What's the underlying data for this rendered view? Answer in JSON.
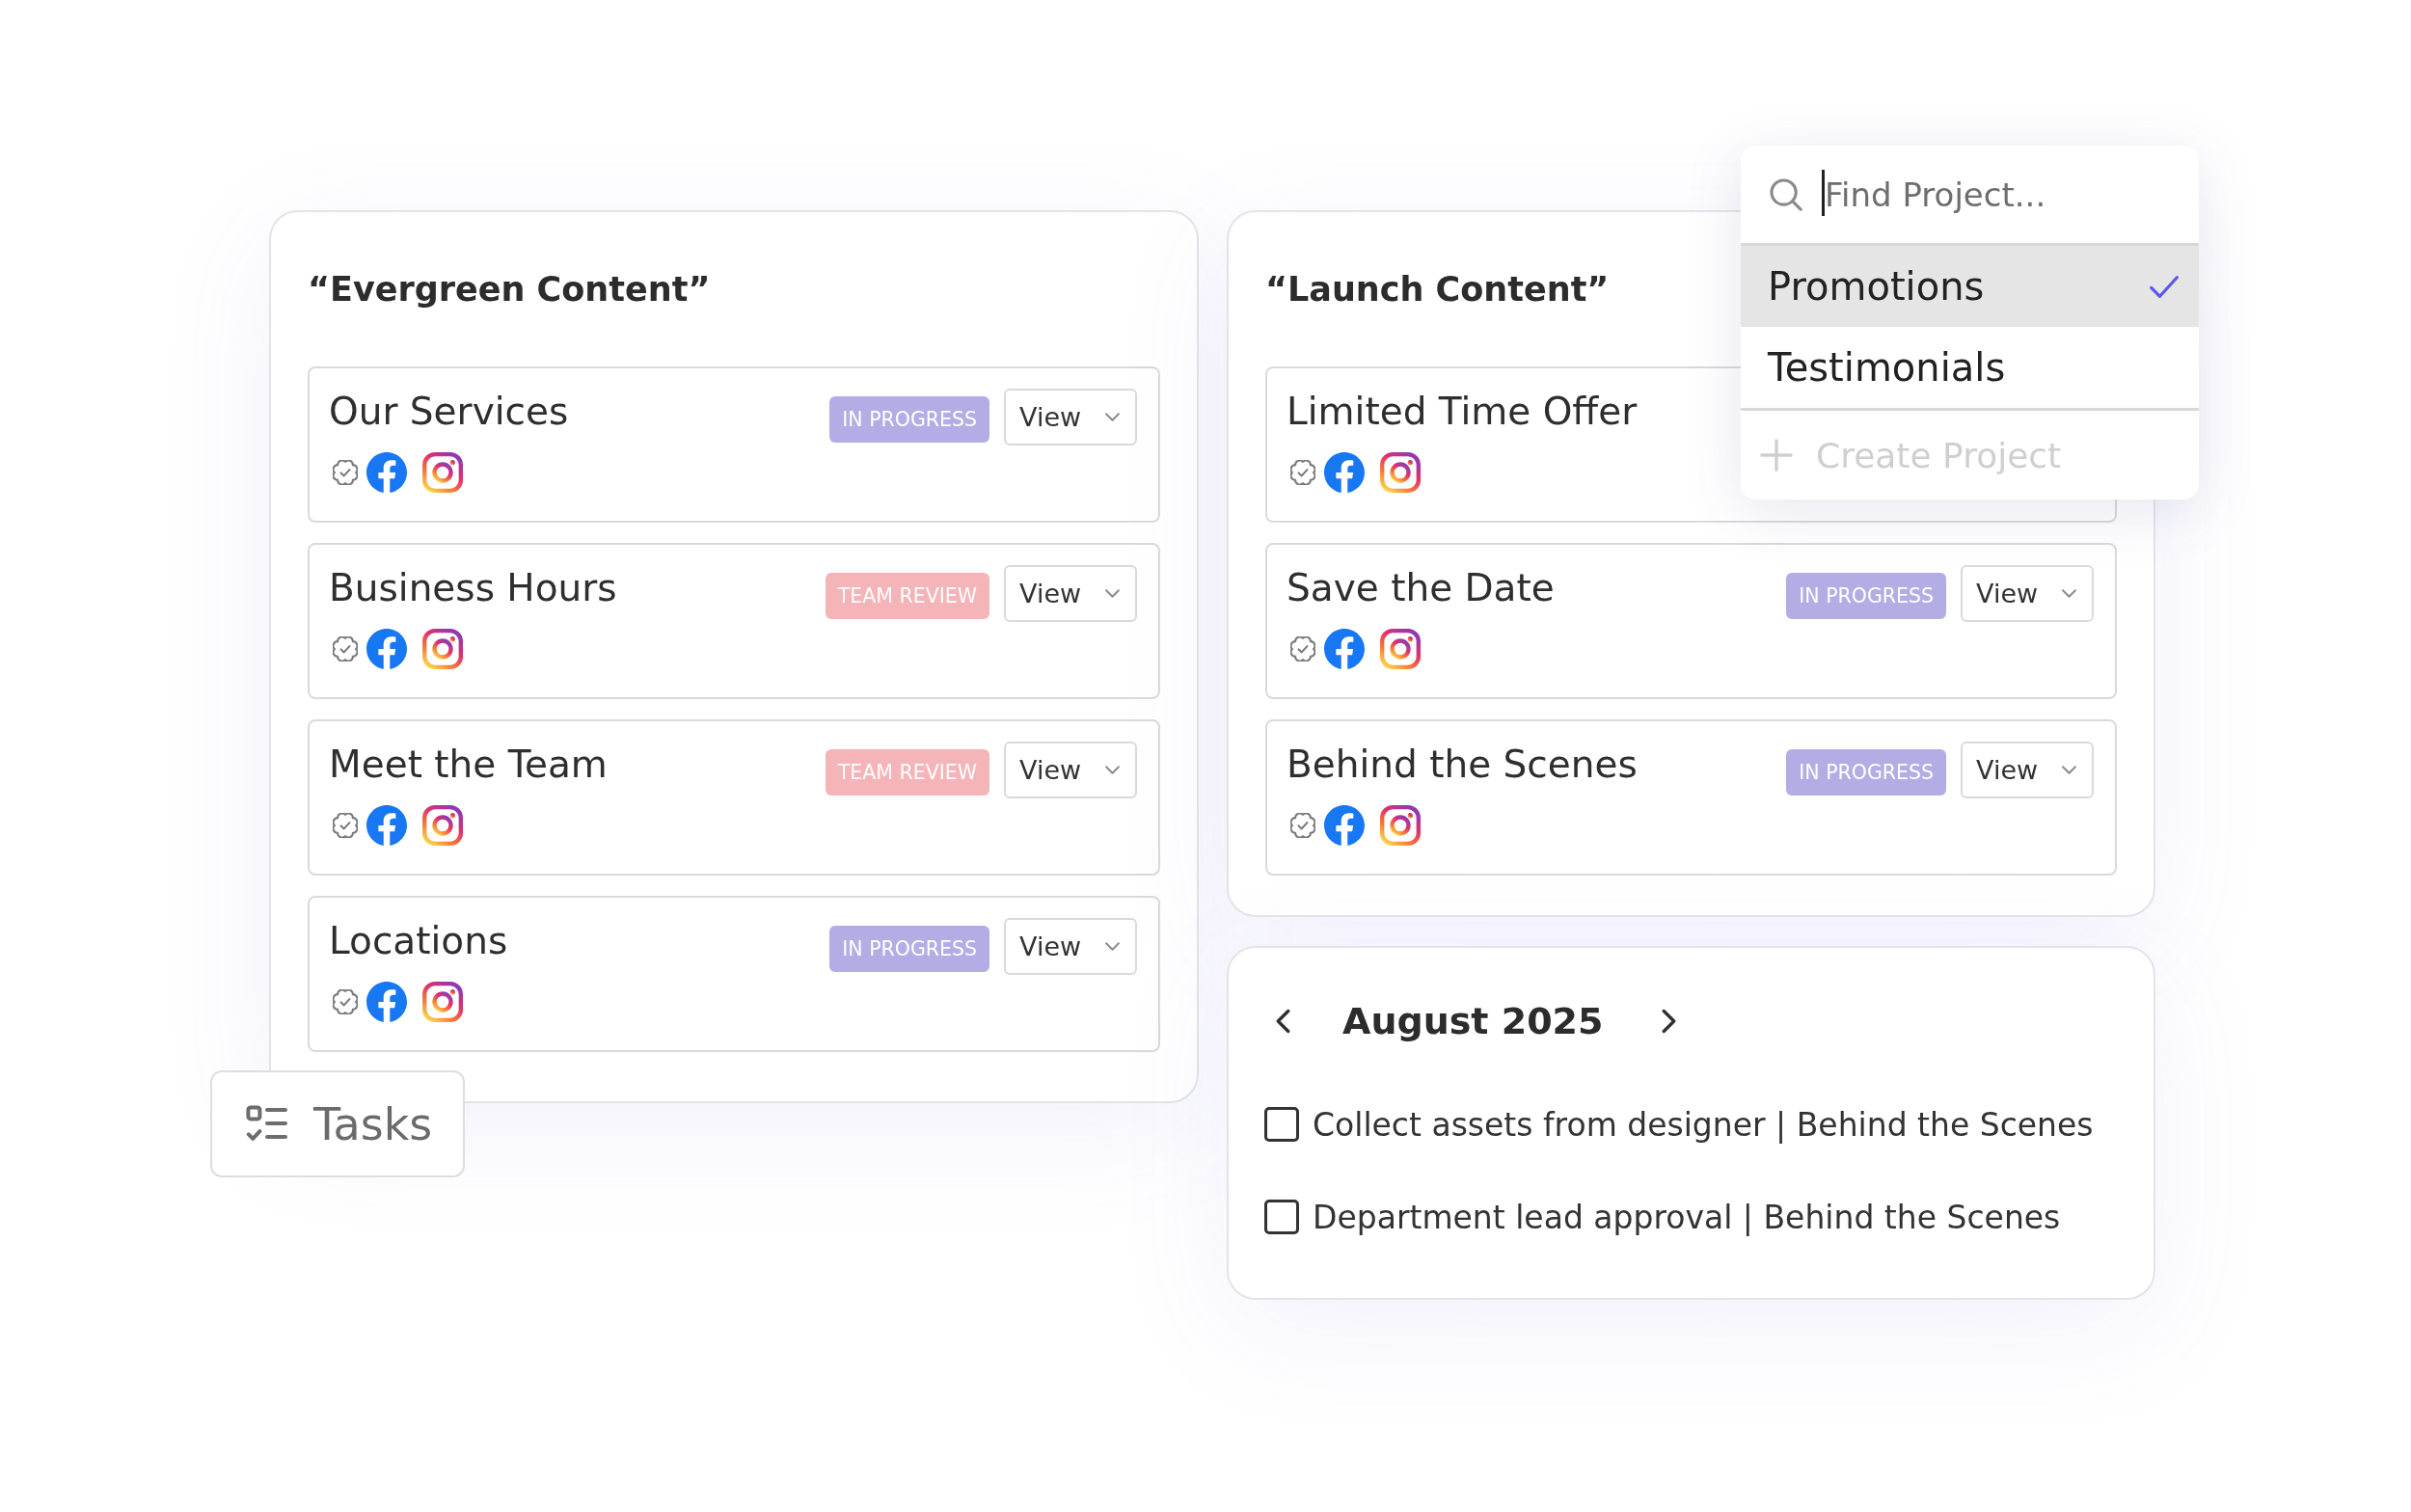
{
  "project_picker": {
    "search": {
      "placeholder": "Find Project...",
      "focused": true
    },
    "options": [
      {
        "label": "Promotions",
        "selected": true
      },
      {
        "label": "Testimonials",
        "selected": false
      }
    ],
    "create_action": {
      "label": "Create Project",
      "disabled": true
    }
  },
  "boards": [
    {
      "title": "“Evergreen Content”",
      "items": [
        {
          "title": "Our Services",
          "status": {
            "label": "IN PROGRESS",
            "kind": "in_progress"
          },
          "view_button": "View"
        },
        {
          "title": "Business Hours",
          "status": {
            "label": "TEAM REVIEW",
            "kind": "team_review"
          },
          "view_button": "View"
        },
        {
          "title": "Meet the Team",
          "status": {
            "label": "TEAM REVIEW",
            "kind": "team_review"
          },
          "view_button": "View"
        },
        {
          "title": "Locations",
          "status": {
            "label": "IN PROGRESS",
            "kind": "in_progress"
          },
          "view_button": "View"
        }
      ]
    },
    {
      "title": "“Launch Content”",
      "items": [
        {
          "title": "Limited Time Offer"
        },
        {
          "title": "Save the Date",
          "status": {
            "label": "IN PROGRESS",
            "kind": "in_progress"
          },
          "view_button": "View"
        },
        {
          "title": "Behind the Scenes",
          "status": {
            "label": "IN PROGRESS",
            "kind": "in_progress"
          },
          "view_button": "View"
        }
      ]
    }
  ],
  "calendar": {
    "month": "August 2025",
    "tasks": [
      {
        "label": "Collect assets from designer | Behind the Scenes",
        "checked": false
      },
      {
        "label": "Department lead approval | Behind the Scenes",
        "checked": false
      }
    ]
  },
  "tasks_tab": {
    "label": "Tasks"
  }
}
